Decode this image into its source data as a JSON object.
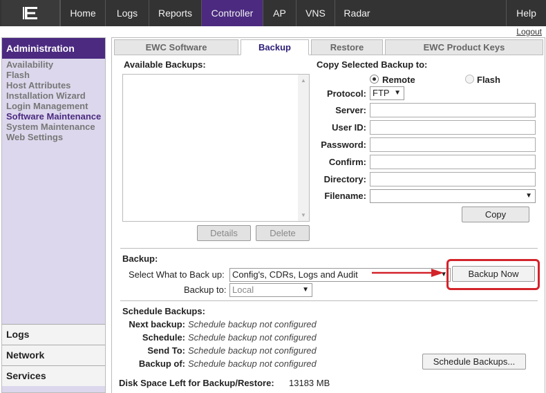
{
  "nav": {
    "items": [
      {
        "label": "Home"
      },
      {
        "label": "Logs"
      },
      {
        "label": "Reports"
      },
      {
        "label": "Controller"
      },
      {
        "label": "AP"
      },
      {
        "label": "VNS"
      },
      {
        "label": "Radar"
      },
      {
        "label": "Help"
      }
    ],
    "logout": "Logout",
    "active": "Controller"
  },
  "sidebar": {
    "heading": "Administration",
    "items": [
      {
        "label": "Availability"
      },
      {
        "label": "Flash"
      },
      {
        "label": "Host Attributes"
      },
      {
        "label": "Installation Wizard"
      },
      {
        "label": "Login Management"
      },
      {
        "label": "Software Maintenance"
      },
      {
        "label": "System Maintenance"
      },
      {
        "label": "Web Settings"
      }
    ],
    "sections": [
      {
        "label": "Logs"
      },
      {
        "label": "Network"
      },
      {
        "label": "Services"
      }
    ]
  },
  "tabs": [
    {
      "label": "EWC Software"
    },
    {
      "label": "Backup"
    },
    {
      "label": "Restore"
    },
    {
      "label": "EWC Product Keys"
    }
  ],
  "available_backups": {
    "title": "Available Backups:",
    "details": "Details",
    "delete": "Delete"
  },
  "copy": {
    "title": "Copy Selected Backup to:",
    "remote": "Remote",
    "flash": "Flash",
    "protocol_label": "Protocol:",
    "protocol_value": "FTP",
    "server_label": "Server:",
    "userid_label": "User ID:",
    "password_label": "Password:",
    "confirm_label": "Confirm:",
    "directory_label": "Directory:",
    "filename_label": "Filename:",
    "copy_button": "Copy"
  },
  "backup": {
    "title": "Backup:",
    "select_label": "Select What to Back up:",
    "select_value": "Config's, CDRs, Logs and Audit",
    "backup_to_label": "Backup to:",
    "backup_to_value": "Local",
    "backup_now": "Backup Now"
  },
  "schedule": {
    "title": "Schedule Backups:",
    "rows": [
      {
        "label": "Next backup:",
        "value": "Schedule backup not configured"
      },
      {
        "label": "Schedule:",
        "value": "Schedule backup not configured"
      },
      {
        "label": "Send To:",
        "value": "Schedule backup not configured"
      },
      {
        "label": "Backup of:",
        "value": "Schedule backup not configured"
      }
    ],
    "button": "Schedule Backups..."
  },
  "disk": {
    "label": "Disk Space Left for Backup/Restore:",
    "value": "13183 MB"
  },
  "colors": {
    "nav_bg": "#333334",
    "accent": "#4b2a80",
    "annotation": "#d3232a"
  }
}
